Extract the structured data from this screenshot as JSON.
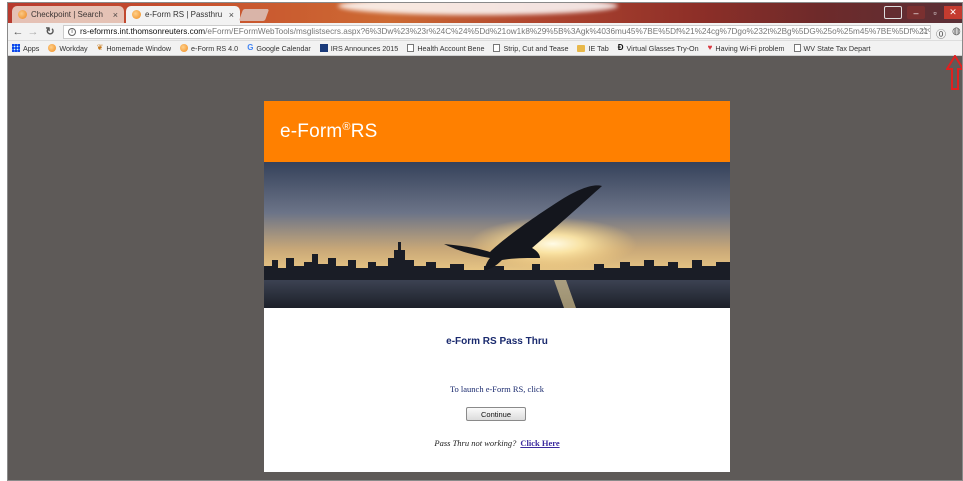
{
  "browser": {
    "tabs": [
      {
        "label": "Checkpoint | Search",
        "active": false
      },
      {
        "label": "e-Form RS | Passthru",
        "active": true
      }
    ],
    "close_glyph": "×",
    "address": {
      "host": "rs-eformrs.int.thomsonreuters.com",
      "path": "/eForm/EFormWebTools/msglistsecrs.aspx?6%3Dw%23%23r%24C%24%5Dd%21ow1k8%29%5B%3Agk%4036mu45%7BE%5Df%21%24cg%7Dgo%232t%2Bg%5DG%25o%25m45%7BE%5Df%21%24"
    },
    "bookmarks": [
      {
        "label": "Apps",
        "icon": "apps-grid-icon"
      },
      {
        "label": "Workday",
        "icon": "orange-circle-icon"
      },
      {
        "label": "Homemade Window",
        "icon": "leaf-icon"
      },
      {
        "label": "e-Form RS 4.0",
        "icon": "orange-circle-icon"
      },
      {
        "label": "Google Calendar",
        "icon": "google-icon"
      },
      {
        "label": "IRS Announces 2015",
        "icon": "irs-icon"
      },
      {
        "label": "Health Account Bene",
        "icon": "page-icon"
      },
      {
        "label": "Strip, Cut and Tease",
        "icon": "page-icon"
      },
      {
        "label": "IE Tab",
        "icon": "folder-icon"
      },
      {
        "label": "Virtual Glasses Try-On",
        "icon": "d-icon"
      },
      {
        "label": "Having Wi-Fi problem",
        "icon": "heart-icon"
      },
      {
        "label": "WV State Tax Depart",
        "icon": "page-icon"
      }
    ],
    "accent_colors": {
      "tabstrip": "#b83a2e",
      "annotation_arrow": "#e02020"
    }
  },
  "page": {
    "logo_text": "e-Form",
    "logo_mark": "®",
    "logo_suffix": "RS",
    "banner_color": "#ff8000",
    "title": "e-Form RS Pass Thru",
    "launch_text": "To launch e-Form RS, click",
    "continue_label": "Continue",
    "help_question": "Pass Thru not working?",
    "help_link": "Click Here"
  }
}
